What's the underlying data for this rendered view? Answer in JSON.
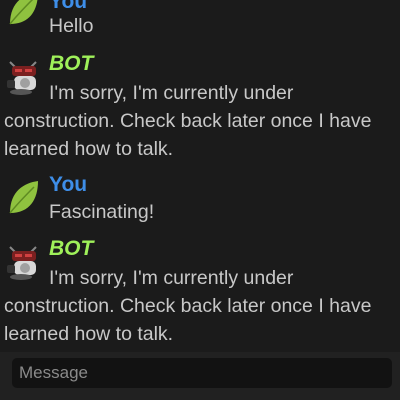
{
  "messages": [
    {
      "author": "You",
      "text": "Hello",
      "type": "user"
    },
    {
      "author": "BOT",
      "text": "I'm sorry, I'm currently under construction. Check back later once I have learned how to talk.",
      "type": "bot"
    },
    {
      "author": "You",
      "text": "Fascinating!",
      "type": "user"
    },
    {
      "author": "BOT",
      "text": "I'm sorry, I'm currently under construction. Check back later once I have learned how to talk.",
      "type": "bot"
    }
  ],
  "composer": {
    "placeholder": "Message"
  },
  "colors": {
    "user_name": "#3e8ee8",
    "bot_name": "#9ff05a",
    "background": "#1b1b1b"
  },
  "icons": {
    "user_avatar": "leaf-icon",
    "bot_avatar": "robot-icon"
  }
}
